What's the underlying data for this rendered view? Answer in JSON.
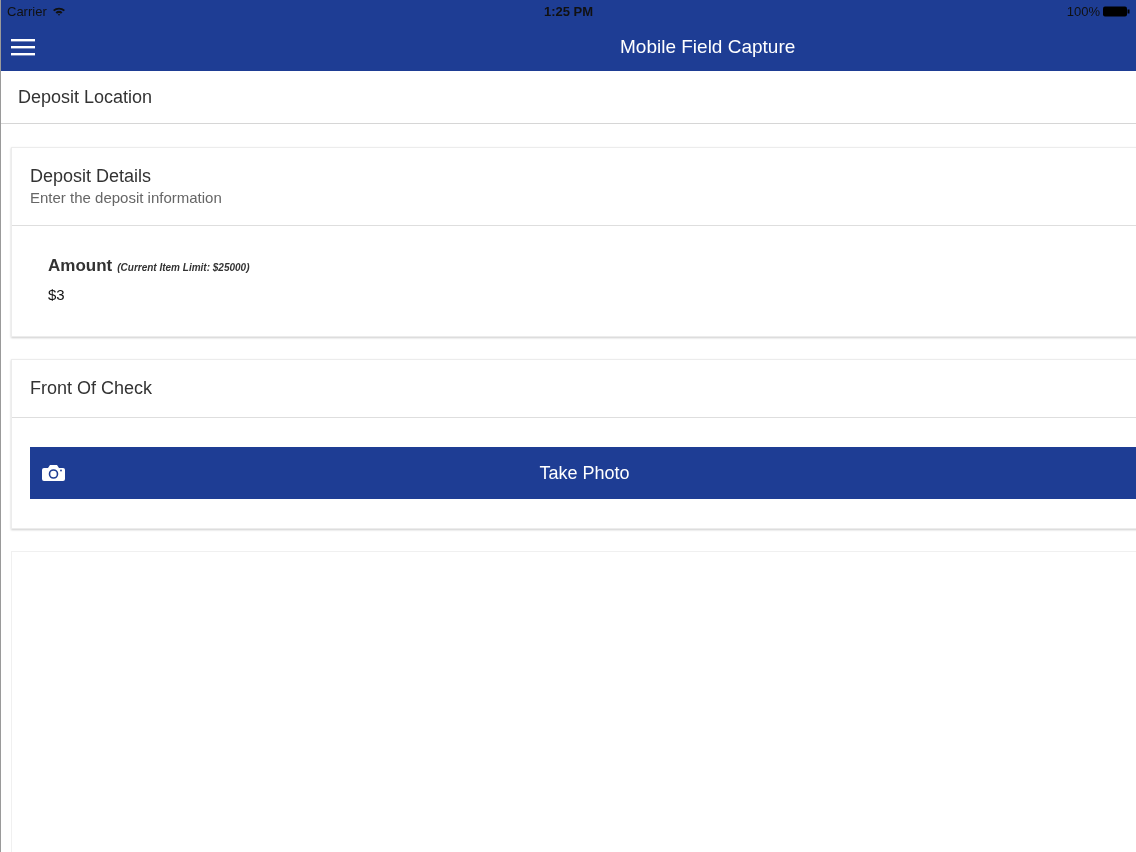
{
  "status_bar": {
    "carrier": "Carrier",
    "time": "1:25 PM",
    "battery": "100%"
  },
  "nav_bar": {
    "title": "Mobile Field Capture"
  },
  "location": {
    "label": "Deposit Location"
  },
  "details_card": {
    "title": "Deposit Details",
    "subtitle": "Enter the deposit information",
    "field": {
      "label": "Amount",
      "note": "(Current Item Limit: $25000)",
      "value": "$3"
    }
  },
  "check_card": {
    "title": "Front Of Check",
    "button": "Take Photo"
  }
}
